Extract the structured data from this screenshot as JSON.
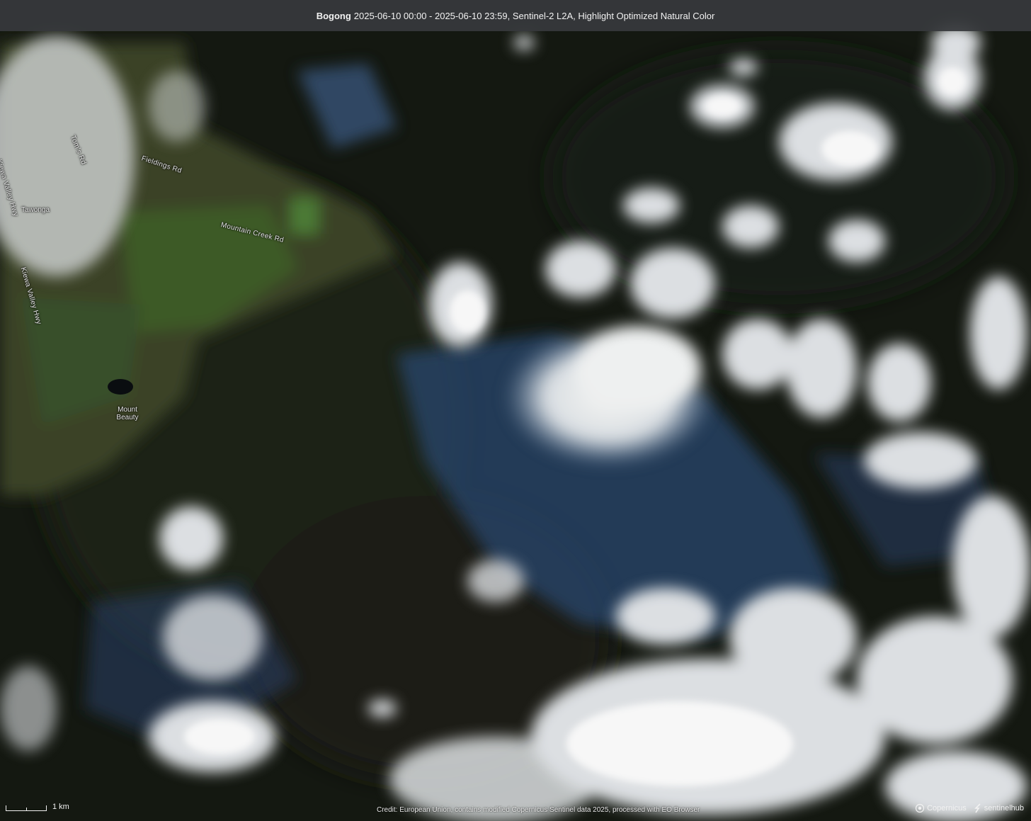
{
  "header": {
    "location": "Bogong",
    "details": "2025-06-10 00:00 - 2025-06-10 23:59, Sentinel-2 L2A, Highlight Optimized Natural Color"
  },
  "map": {
    "roads": [
      "Kiewa Valley Hwy",
      "Tom's Rd",
      "Fieldings Rd",
      "Mountain Creek Rd",
      "Kiewa Valley Hwy"
    ],
    "places": [
      "Tawonga",
      "Mount Beauty"
    ]
  },
  "scale": {
    "label": "1 km"
  },
  "credit": "Credit: European Union, contains modified Copernicus Sentinel data 2025, processed with EO Browser",
  "logos": {
    "copernicus": "Copernicus",
    "sentinelhub": "sentinelhub"
  }
}
